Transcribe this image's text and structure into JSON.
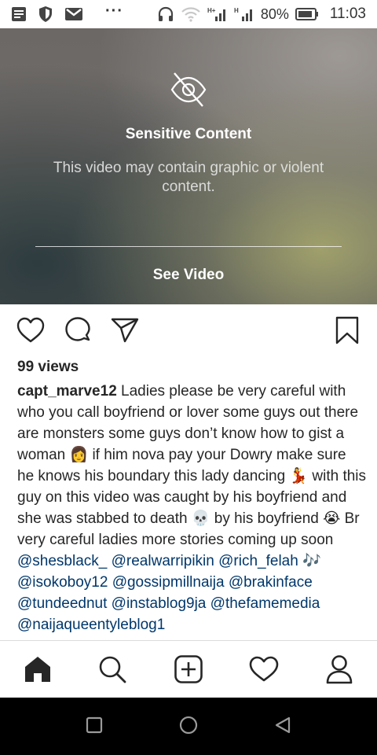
{
  "status_bar": {
    "battery_percent": "80%",
    "time": "11:03",
    "more_dots": "···",
    "icons": [
      "notes-icon",
      "shield-icon",
      "gmail-icon",
      "headphones-icon",
      "wifi-icon",
      "signal-h-icon",
      "signal-h-icon",
      "battery-icon"
    ]
  },
  "video": {
    "title": "Sensitive Content",
    "description": "This video may contain graphic or violent content.",
    "see_video_label": "See Video",
    "icon": "eye-off-icon"
  },
  "post": {
    "views": "99 views",
    "username": "capt_marve12",
    "caption_text": " Ladies please be very careful with who you call boyfriend or lover some guys out there are monsters some guys  don’t know how to gist a woman 👩 if him nova pay your Dowry make sure he knows his boundary this lady dancing 💃 with this guy on this video was caught by his boyfriend and she was stabbed to death 💀 by his boyfriend 😭 Br very careful ladies more stories coming up soon ",
    "mentions": [
      "@shesblack_",
      "@realwarripikin",
      "@rich_felah",
      "🎶",
      "@isokoboy12",
      "@gossipmillnaija",
      "@brakinface",
      "@tundeednut",
      "@instablog9ja",
      "@thefamemedia",
      "@naijaqueentyleblog1"
    ],
    "actions": [
      "like-icon",
      "comment-icon",
      "share-icon",
      "save-icon"
    ]
  },
  "bottom_nav": [
    "home-icon",
    "search-icon",
    "new-post-icon",
    "activity-icon",
    "profile-icon"
  ],
  "system_nav": [
    "recents-icon",
    "home-circle-icon",
    "back-icon"
  ],
  "colors": {
    "mention": "#00376b",
    "text": "#262626",
    "divider": "#dbdbdb"
  }
}
